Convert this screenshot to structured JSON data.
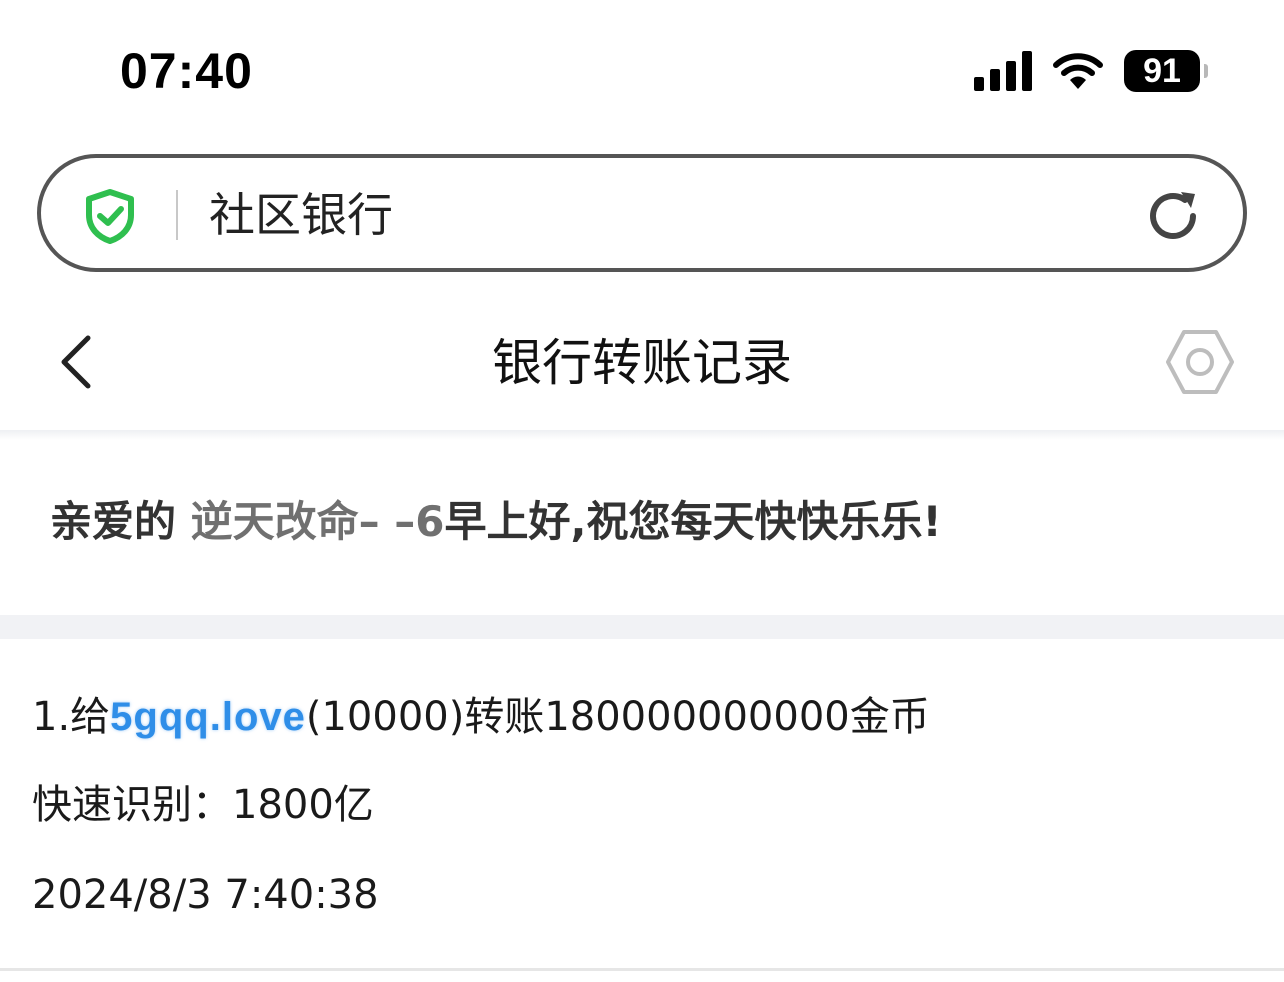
{
  "status_bar": {
    "time": "07:40",
    "battery": "91",
    "icons": [
      "signal-icon",
      "wifi-icon",
      "battery-icon"
    ]
  },
  "address_bar": {
    "title": "社区银行",
    "icons": [
      "shield-check-icon",
      "reload-icon"
    ],
    "colors": {
      "shield": "#2fbf4f"
    }
  },
  "nav": {
    "title": "银行转账记录",
    "icons": [
      "back-chevron-icon",
      "settings-hexagon-icon"
    ]
  },
  "greeting": {
    "prefix": "亲爱的 ",
    "name": "逆天改命– –6",
    "suffix": "早上好,祝您每天快快乐乐!"
  },
  "records": [
    {
      "index_prefix": "1.给",
      "recipient": "5gqq.love",
      "detail": "(10000)转账180000000000金币",
      "quick_label": "快速识别：",
      "quick_value": "1800亿",
      "timestamp": "2024/8/3 7:40:38"
    }
  ],
  "colors": {
    "link": "#2f8ee8",
    "band": "#f1f2f5",
    "text": "#1a1a1a"
  }
}
